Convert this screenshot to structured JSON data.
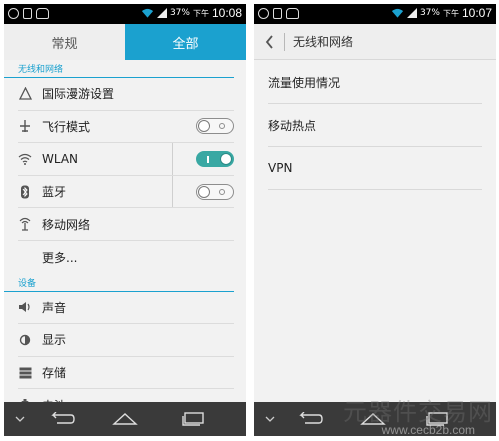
{
  "left_screen": {
    "status_bar": {
      "battery": "37%",
      "period": "下午",
      "time": "10:08"
    },
    "tabs": [
      {
        "label": "常规",
        "active": false
      },
      {
        "label": "全部",
        "active": true
      }
    ],
    "sections": [
      {
        "header": "无线和网络",
        "items": [
          {
            "label": "国际漫游设置",
            "icon": "triangle-icon"
          },
          {
            "label": "飞行模式",
            "icon": "airplane-icon",
            "switch": "off"
          },
          {
            "label": "WLAN",
            "icon": "wifi-icon",
            "switch": "on"
          },
          {
            "label": "蓝牙",
            "icon": "bluetooth-icon",
            "switch": "off"
          },
          {
            "label": "移动网络",
            "icon": "mobile-network-icon"
          },
          {
            "label": "更多..."
          }
        ]
      },
      {
        "header": "设备",
        "items": [
          {
            "label": "声音",
            "icon": "volume-icon"
          },
          {
            "label": "显示",
            "icon": "brightness-icon"
          },
          {
            "label": "存储",
            "icon": "storage-icon"
          },
          {
            "label": "电池",
            "icon": "battery-icon"
          }
        ]
      }
    ]
  },
  "right_screen": {
    "status_bar": {
      "battery": "37%",
      "period": "下午",
      "time": "10:07"
    },
    "header_title": "无线和网络",
    "items": [
      "流量使用情况",
      "移动热点",
      "VPN"
    ]
  },
  "watermark": {
    "text": "元器件交易网",
    "url": "www.cecb2b.com"
  },
  "colors": {
    "accent": "#1ba1cf",
    "switch_on": "#39a8a3",
    "statusbar": "#000000",
    "navbar": "#3a3a3a"
  }
}
